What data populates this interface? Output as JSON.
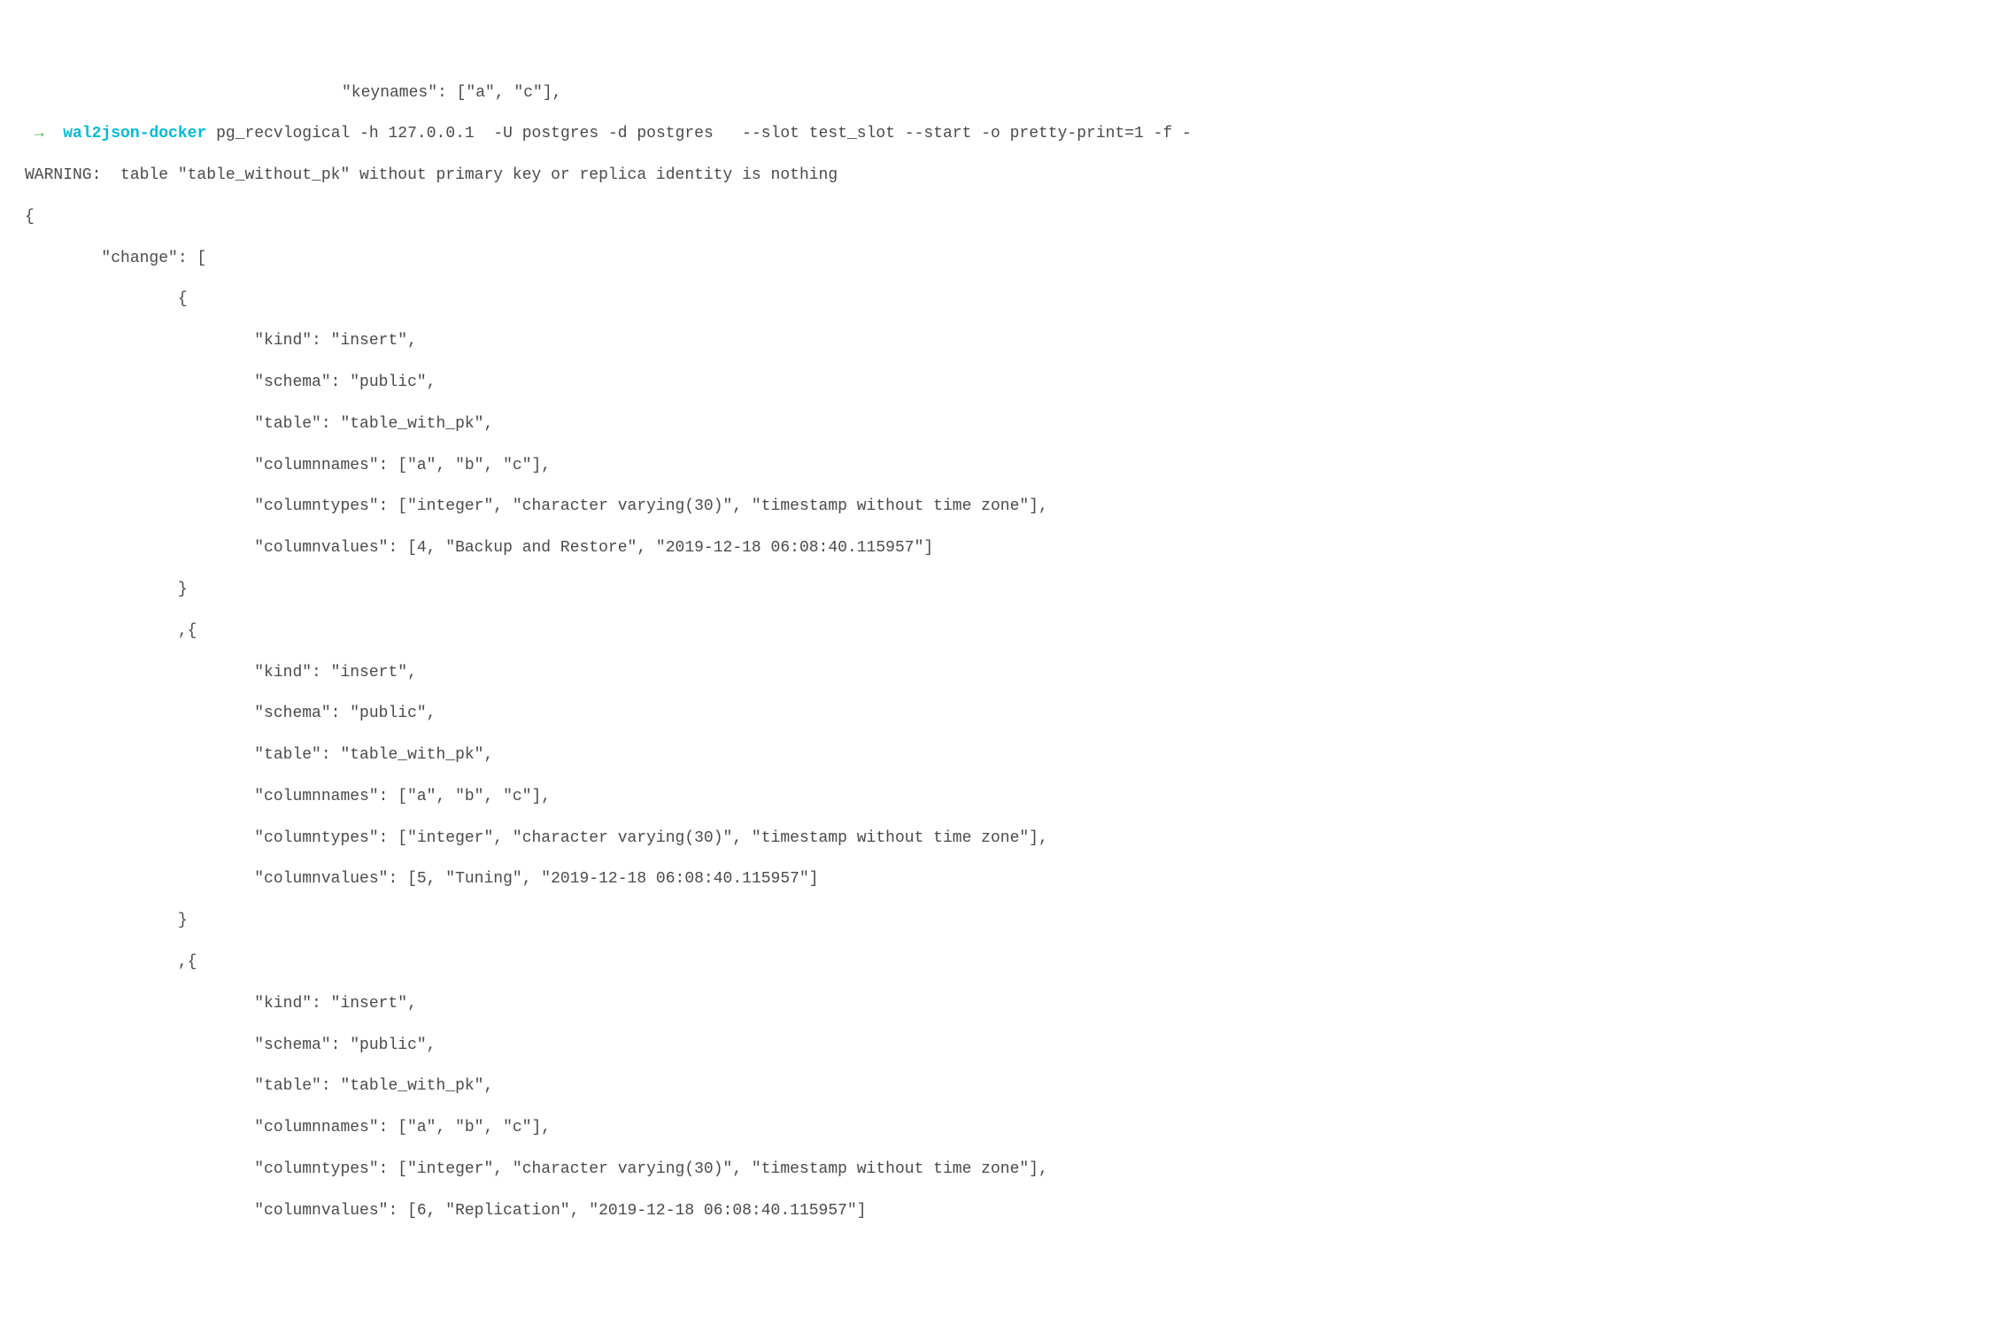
{
  "terminal": {
    "partial_top": "\"keynames\": [\"a\", \"c\"],",
    "prompt_arrow": "→",
    "dirname": "wal2json-docker",
    "command": "pg_recvlogical -h 127.0.0.1  -U postgres -d postgres   --slot test_slot --start -o pretty-print=1 -f -",
    "warning": "WARNING:  table \"table_without_pk\" without primary key or replica identity is nothing",
    "json_lines": [
      "{",
      "        \"change\": [",
      "                {",
      "                        \"kind\": \"insert\",",
      "                        \"schema\": \"public\",",
      "                        \"table\": \"table_with_pk\",",
      "                        \"columnnames\": [\"a\", \"b\", \"c\"],",
      "                        \"columntypes\": [\"integer\", \"character varying(30)\", \"timestamp without time zone\"],",
      "                        \"columnvalues\": [4, \"Backup and Restore\", \"2019-12-18 06:08:40.115957\"]",
      "                }",
      "                ,{",
      "                        \"kind\": \"insert\",",
      "                        \"schema\": \"public\",",
      "                        \"table\": \"table_with_pk\",",
      "                        \"columnnames\": [\"a\", \"b\", \"c\"],",
      "                        \"columntypes\": [\"integer\", \"character varying(30)\", \"timestamp without time zone\"],",
      "                        \"columnvalues\": [5, \"Tuning\", \"2019-12-18 06:08:40.115957\"]",
      "                }",
      "                ,{",
      "                        \"kind\": \"insert\",",
      "                        \"schema\": \"public\",",
      "                        \"table\": \"table_with_pk\",",
      "                        \"columnnames\": [\"a\", \"b\", \"c\"],",
      "                        \"columntypes\": [\"integer\", \"character varying(30)\", \"timestamp without time zone\"],",
      "                        \"columnvalues\": [6, \"Replication\", \"2019-12-18 06:08:40.115957\"]"
    ]
  }
}
